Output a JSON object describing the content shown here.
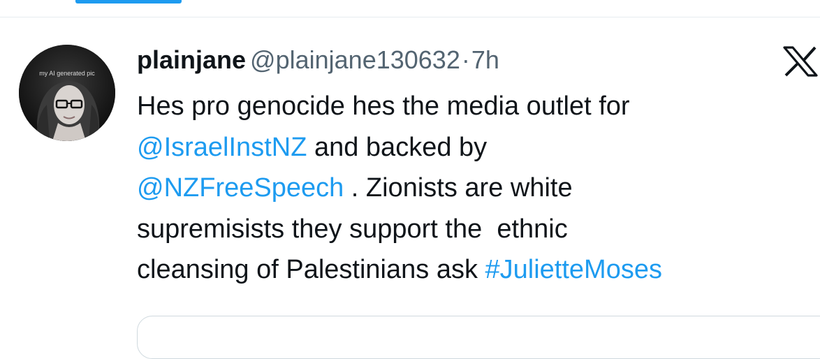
{
  "tweet": {
    "display_name": "plainjane",
    "handle": "@plainjane130632",
    "separator": "·",
    "time": "7h",
    "avatar_caption": "my AI generated pic",
    "text": {
      "l1": "Hes pro genocide hes the media outlet for",
      "l2_mention": "@IsraelInstNZ",
      "l2_rest": " and backed by",
      "l3_mention": "@NZFreeSpeech",
      "l3_rest": " . Zionists are white",
      "l4": "supremisists they support the  ethnic",
      "l5_start": "cleansing of Palestinians ask ",
      "l5_hashtag": "#JulietteMoses"
    }
  },
  "colors": {
    "link": "#1d9bf0",
    "secondary_text": "#536471",
    "primary_text": "#0f1419"
  },
  "icons": {
    "top_right": "x-logo-icon"
  }
}
